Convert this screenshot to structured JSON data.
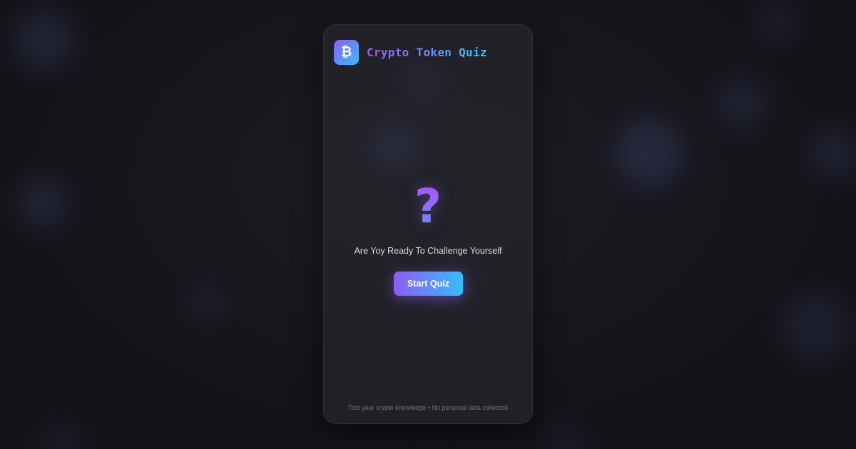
{
  "app": {
    "title": "Crypto Token Quiz",
    "logo_glyph": "₿",
    "logo_icon": "bitcoin-icon"
  },
  "main": {
    "question_glyph": "?",
    "prompt": "Are Yoy Ready To Challenge Yourself",
    "start_label": "Start Quiz"
  },
  "footer": {
    "text": "Test your crypto knowledge • No personal data collected"
  },
  "colors": {
    "gradient_start": "#8b5cf6",
    "gradient_end": "#38bdf8",
    "background": "#151419",
    "card": "#26252c"
  }
}
